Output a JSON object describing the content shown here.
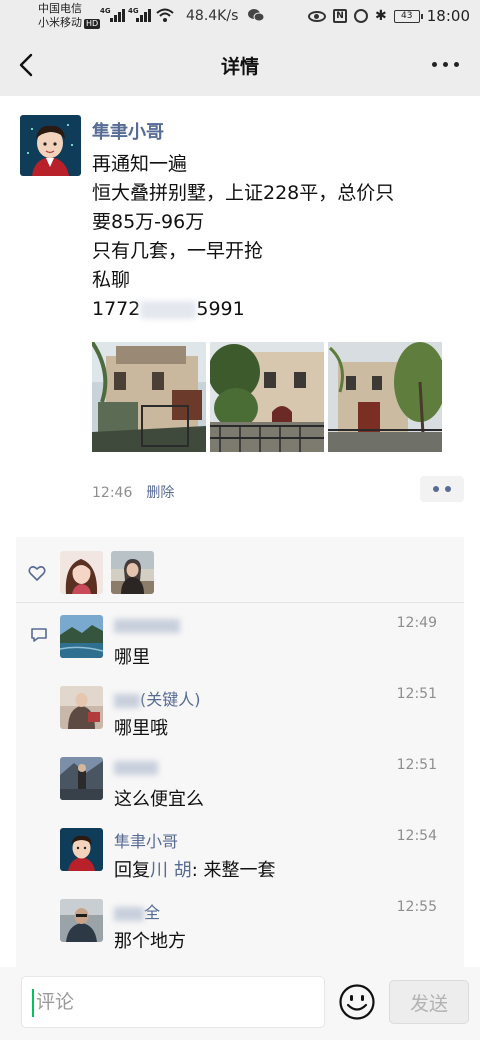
{
  "status_bar": {
    "carrier_1": "中国电信",
    "carrier_2": "小米移动",
    "hd_badge": "HD",
    "network_1": "4G",
    "network_2": "4G",
    "net_speed": "48.4K/s",
    "nfc_label": "N",
    "battery_level": "43",
    "time": "18:00"
  },
  "header": {
    "title": "详情"
  },
  "post": {
    "author": "隼聿小哥",
    "lines": [
      "再通知一遍",
      "恒大叠拼别墅，上证228平，总价只",
      "要85万-96万",
      "只有几套，一早开抢",
      "私聊"
    ],
    "phone_prefix": "1772",
    "phone_suffix": "5991",
    "time": "12:46",
    "delete_label": "删除"
  },
  "comments": [
    {
      "name": "",
      "time": "12:49",
      "text": "哪里"
    },
    {
      "name": "(关键人)",
      "time": "12:51",
      "text": "哪里哦"
    },
    {
      "name": "",
      "time": "12:51",
      "text": "这么便宜么"
    },
    {
      "name": "隼聿小哥",
      "time": "12:54",
      "reply_prefix": "回复",
      "reply_to": "川 胡",
      "reply_sep": ": ",
      "text": "来整一套"
    },
    {
      "name": "全",
      "time": "12:55",
      "text": "那个地方"
    }
  ],
  "composer": {
    "placeholder": "评论",
    "send_label": "发送"
  },
  "colors": {
    "link": "#576b95",
    "background": "#ededed",
    "panel": "#f7f7f7",
    "caret": "#07c160"
  }
}
